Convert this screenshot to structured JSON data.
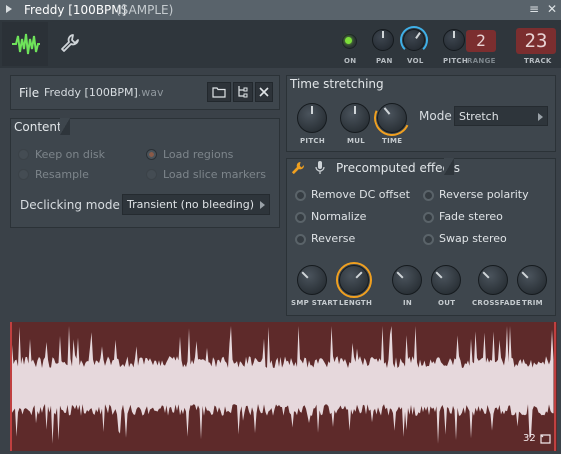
{
  "window": {
    "title": "Freddy [100BPM]",
    "subtitle": "(SAMPLE)",
    "close_glyph": "✕",
    "menu_glyph": "≡"
  },
  "toolbar": {
    "on_label": "ON",
    "pan_label": "PAN",
    "vol_label": "VOL",
    "pitch_label": "PITCH",
    "range_label": "RANGE",
    "range_value": "2",
    "track_label": "TRACK",
    "track_value": "23"
  },
  "file": {
    "label": "File",
    "name": "Freddy [100BPM]",
    "ext": ".wav"
  },
  "content": {
    "header": "Content",
    "keep_on_disk": "Keep on disk",
    "resample": "Resample",
    "load_regions": "Load regions",
    "load_slice_markers": "Load slice markers",
    "declicking_label": "Declicking mode",
    "declicking_value": "Transient (no bleeding)"
  },
  "time_stretching": {
    "header": "Time stretching",
    "pitch_label": "PITCH",
    "mul_label": "MUL",
    "time_label": "TIME",
    "mode_label": "Mode",
    "mode_value": "Stretch"
  },
  "precomputed": {
    "header": "Precomputed effects",
    "remove_dc": "Remove DC offset",
    "normalize": "Normalize",
    "reverse": "Reverse",
    "reverse_polarity": "Reverse polarity",
    "fade_stereo": "Fade stereo",
    "swap_stereo": "Swap stereo",
    "knobs": {
      "smp_start": "SMP START",
      "length": "LENGTH",
      "in": "IN",
      "out": "OUT",
      "crossfade": "CROSSFADE",
      "trim": "TRIM"
    }
  },
  "waveform": {
    "zoom_value": "32"
  },
  "colors": {
    "accent_orange": "#f0a020",
    "accent_blue": "#3fb0e8",
    "led_green": "#7ddf3a",
    "wave_bg": "#5e2a2a",
    "wave_fill": "#e6d8dc"
  },
  "icons": {
    "wave_tab": "waveform-icon",
    "settings_tab": "wrench-icon",
    "folder": "folder-icon",
    "tree": "tree-icon",
    "close": "close-icon",
    "effects_wrench": "wrench-icon",
    "effects_mic": "microphone-icon",
    "loop": "loop-icon"
  }
}
